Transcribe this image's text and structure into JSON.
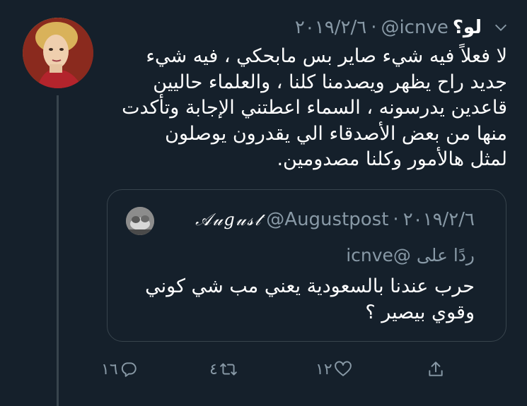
{
  "tweet": {
    "display_name": "لو؟",
    "handle": "@icnve",
    "separator": "·",
    "date": "٢٠١٩/٢/٦",
    "text_lines": [
      "لا فعلاً فيه شيء صاير بس مابحكي ، فيه شيء",
      "جديد راح يظهر ويصدمنا كلنا ، والعلماء حاليين",
      "قاعدين يدرسونه ، السماء اعطتني الإجابة وتأكدت",
      "منها من بعض الأصدقاء الي يقدرون يوصلون",
      "لمثل هالأمور وكلنا مصدومين."
    ]
  },
  "quoted": {
    "display_name": "𝒜𝓊𝑔𝓊𝓈𝓉",
    "handle": "@Augustpost",
    "separator": "·",
    "date": "٢٠١٩/٢/٦",
    "reply_prefix": "ردًا على",
    "reply_to": "@icnve",
    "text_lines": [
      "حرب عندنا بالسعودية يعني مب شي كوني",
      "وقوي بيصير ؟"
    ]
  },
  "actions": {
    "reply_count": "١٦",
    "retweet_count": "٤",
    "like_count": "١٢"
  },
  "icons": {
    "menu": "chevron-down-icon",
    "reply": "reply-icon",
    "retweet": "retweet-icon",
    "like": "heart-icon",
    "share": "share-icon"
  },
  "colors": {
    "background": "#15202b",
    "text": "#ffffff",
    "secondary": "#8899a6",
    "border": "#38444d"
  }
}
